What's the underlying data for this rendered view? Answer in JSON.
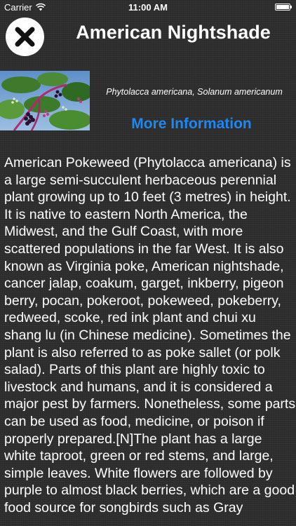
{
  "status_bar": {
    "carrier": "Carrier",
    "time": "11:00 AM",
    "wifi_icon": "wifi-icon",
    "battery_icon": "battery-icon"
  },
  "header": {
    "close_icon": "close-icon",
    "title": "American Nightshade"
  },
  "plant": {
    "photo": "pokeweed-photo",
    "scientific_names": "Phytolacca americana, Solanum americanum",
    "more_info_label": "More Information",
    "link_color": "#1e88f0"
  },
  "description": "American Pokeweed (Phytolacca americana) is a large semi-succulent herbaceous perennial plant growing up to 10 feet (3 metres) in height. It is native to eastern North America, the Midwest, and the Gulf Coast, with more scattered populations in the far West. It is also known as Virginia poke, American nightshade, cancer jalap, coakum, garget, inkberry, pigeon berry, pocan, pokeroot, pokeweed, pokeberry, redweed, scoke, red ink plant and chui xu shang lu (in Chinese medicine). Sometimes the plant is also referred to as poke sallet (or polk salad). Parts of this plant are highly toxic to livestock and humans, and it is considered a major pest by farmers. Nonetheless, some parts can be used as food, medicine, or poison if properly prepared.[N]The plant has a large white taproot, green or red stems, and large, simple leaves. White flowers are followed by purple to almost black berries, which are a good food source for songbirds such as Gray"
}
